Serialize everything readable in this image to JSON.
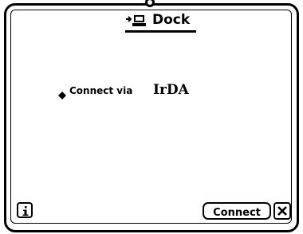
{
  "window": {
    "title": "Dock"
  },
  "connection": {
    "prefix_label": "Connect via",
    "method_value": "IrDA"
  },
  "buttons": {
    "connect_label": "Connect",
    "info_icon": "info-icon",
    "close_icon": "close-icon"
  },
  "icons": {
    "title_icon": "dock-icon",
    "bullet_icon": "diamond-icon"
  },
  "colors": {
    "foreground": "#000000",
    "background": "#ffffff"
  }
}
